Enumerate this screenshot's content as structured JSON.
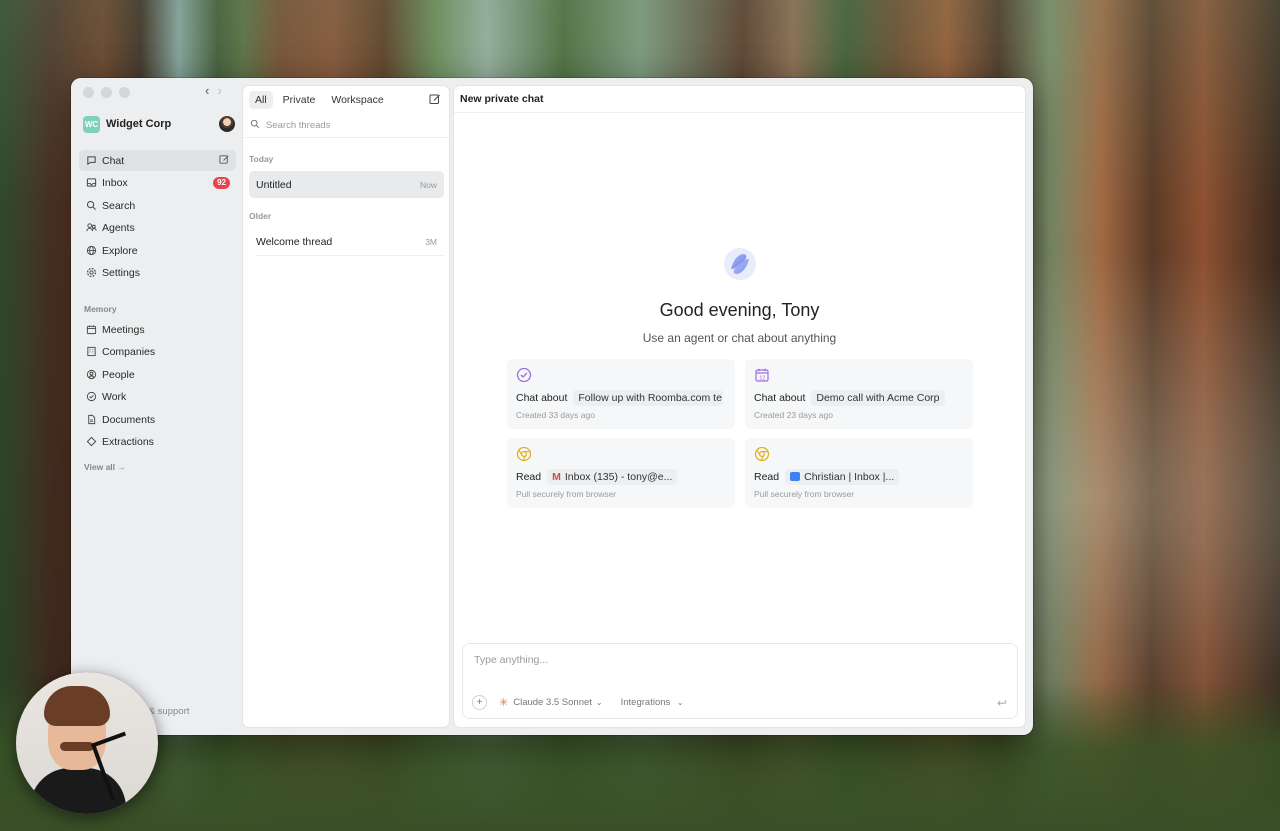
{
  "sidebar": {
    "org_initials": "WC",
    "org_name": "Widget Corp",
    "nav": [
      {
        "label": "Chat",
        "icon": "chat-icon"
      },
      {
        "label": "Inbox",
        "icon": "inbox-icon",
        "badge": "92"
      },
      {
        "label": "Search",
        "icon": "search-icon"
      },
      {
        "label": "Agents",
        "icon": "agents-icon"
      },
      {
        "label": "Explore",
        "icon": "globe-icon"
      },
      {
        "label": "Settings",
        "icon": "gear-icon"
      }
    ],
    "memory_label": "Memory",
    "memory": [
      {
        "label": "Meetings",
        "icon": "calendar-icon"
      },
      {
        "label": "Companies",
        "icon": "building-icon"
      },
      {
        "label": "People",
        "icon": "person-icon"
      },
      {
        "label": "Work",
        "icon": "check-circle-icon"
      },
      {
        "label": "Documents",
        "icon": "document-icon"
      },
      {
        "label": "Extractions",
        "icon": "diamond-icon"
      }
    ],
    "view_all": "View all",
    "feedback": "back & support"
  },
  "threads": {
    "tabs": [
      "All",
      "Private",
      "Workspace"
    ],
    "search_placeholder": "Search threads",
    "today_label": "Today",
    "older_label": "Older",
    "items": [
      {
        "title": "Untitled",
        "time": "Now"
      },
      {
        "title": "Welcome thread",
        "time": "3M"
      }
    ]
  },
  "main": {
    "header": "New private chat",
    "greeting": "Good evening, Tony",
    "subgreeting": "Use an agent or chat about anything",
    "cards": [
      {
        "action": "Chat about",
        "chip": "Follow up with Roomba.com te",
        "meta": "Created 33 days ago",
        "icon": "check-circle-icon"
      },
      {
        "action": "Chat about",
        "chip": "Demo call with Acme Corp",
        "meta": "Created 23 days ago",
        "icon": "calendar-icon"
      },
      {
        "action": "Read",
        "chip": "Inbox (135) - tony@e...",
        "meta": "Pull securely from browser",
        "icon": "chrome-icon"
      },
      {
        "action": "Read",
        "chip": "Christian | Inbox |...",
        "meta": "Pull securely from browser",
        "icon": "chrome-icon"
      }
    ],
    "composer": {
      "placeholder": "Type anything...",
      "model": "Claude 3.5 Sonnet",
      "integrations": "Integrations"
    }
  },
  "colors": {
    "accent_purple": "#9b6ee0",
    "badge_red": "#e8454b",
    "org_logo": "#7fd1b9"
  }
}
